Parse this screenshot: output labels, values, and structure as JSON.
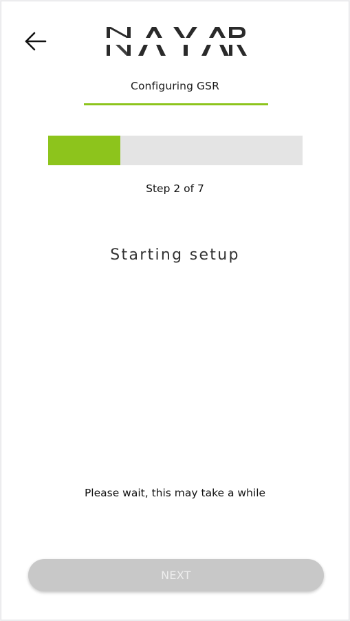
{
  "header": {
    "brand": "NAYAR",
    "back_icon": "arrow-left-icon",
    "subtitle": "Configuring GSR"
  },
  "progress": {
    "current_step": 2,
    "total_steps": 7,
    "fraction": 0.285,
    "label": "Step 2 of 7"
  },
  "main": {
    "heading": "Starting setup",
    "message": "Please wait, this may take a while"
  },
  "footer": {
    "next_label": "NEXT",
    "next_enabled": false
  },
  "colors": {
    "accent": "#8dc41c",
    "track": "#e4e4e4",
    "disabled_button": "#c8c8c8",
    "logo": "#2a2a2a"
  }
}
